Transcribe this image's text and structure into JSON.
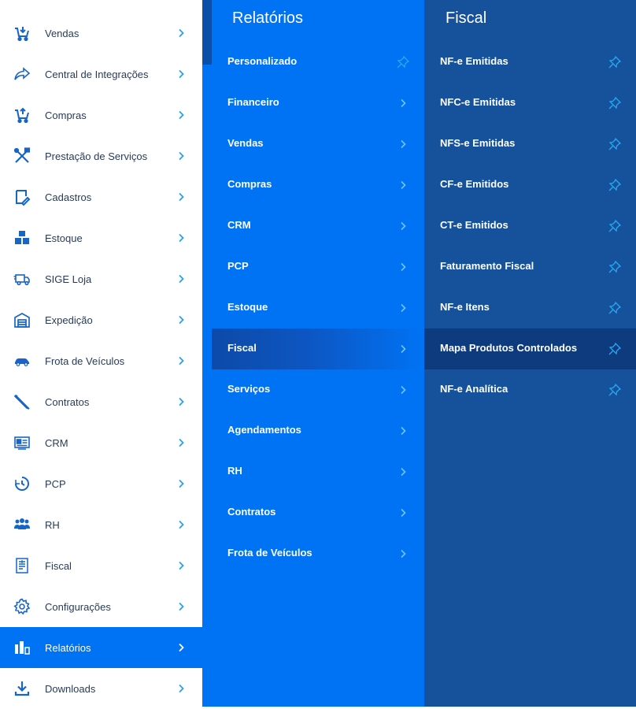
{
  "sidebar": {
    "items": [
      {
        "label": "Vendas",
        "icon": "cart-icon"
      },
      {
        "label": "Central de Integrações",
        "icon": "share-arrow-icon"
      },
      {
        "label": "Compras",
        "icon": "cart-icon"
      },
      {
        "label": "Prestação de Serviços",
        "icon": "tools-icon"
      },
      {
        "label": "Cadastros",
        "icon": "edit-note-icon"
      },
      {
        "label": "Estoque",
        "icon": "boxes-icon"
      },
      {
        "label": "SIGE Loja",
        "icon": "delivery-truck-icon"
      },
      {
        "label": "Expedição",
        "icon": "warehouse-icon"
      },
      {
        "label": "Frota de Veículos",
        "icon": "car-icon"
      },
      {
        "label": "Contratos",
        "icon": "pen-icon"
      },
      {
        "label": "CRM",
        "icon": "id-card-icon"
      },
      {
        "label": "PCP",
        "icon": "clock-icon"
      },
      {
        "label": "RH",
        "icon": "people-icon"
      },
      {
        "label": "Fiscal",
        "icon": "document-icon"
      },
      {
        "label": "Configurações",
        "icon": "gear-icon"
      },
      {
        "label": "Relatórios",
        "icon": "bar-chart-icon",
        "active": true
      },
      {
        "label": "Downloads",
        "icon": "download-icon"
      }
    ]
  },
  "middle_panel": {
    "title": "Relatórios",
    "items": [
      {
        "label": "Personalizado",
        "pinnable": true
      },
      {
        "label": "Financeiro"
      },
      {
        "label": "Vendas"
      },
      {
        "label": "Compras"
      },
      {
        "label": "CRM"
      },
      {
        "label": "PCP"
      },
      {
        "label": "Estoque"
      },
      {
        "label": "Fiscal",
        "active": true
      },
      {
        "label": "Serviços"
      },
      {
        "label": "Agendamentos"
      },
      {
        "label": "RH"
      },
      {
        "label": "Contratos"
      },
      {
        "label": "Frota de Veículos"
      }
    ]
  },
  "right_panel": {
    "title": "Fiscal",
    "items": [
      {
        "label": "NF-e Emitidas"
      },
      {
        "label": "NFC-e Emitidas"
      },
      {
        "label": "NFS-e Emitidas"
      },
      {
        "label": "CF-e Emitidos"
      },
      {
        "label": "CT-e Emitidos"
      },
      {
        "label": "Faturamento Fiscal"
      },
      {
        "label": "NF-e Itens"
      },
      {
        "label": "Mapa Produtos Controlados",
        "active": true
      },
      {
        "label": "NF-e Analítica"
      }
    ]
  },
  "colors": {
    "sidebar_active": "#0073f5",
    "middle_panel_bg": "#0073f5",
    "right_panel_bg": "#16529c",
    "icon_blue": "#1765c9",
    "chevron_light": "#2aa0e6"
  }
}
